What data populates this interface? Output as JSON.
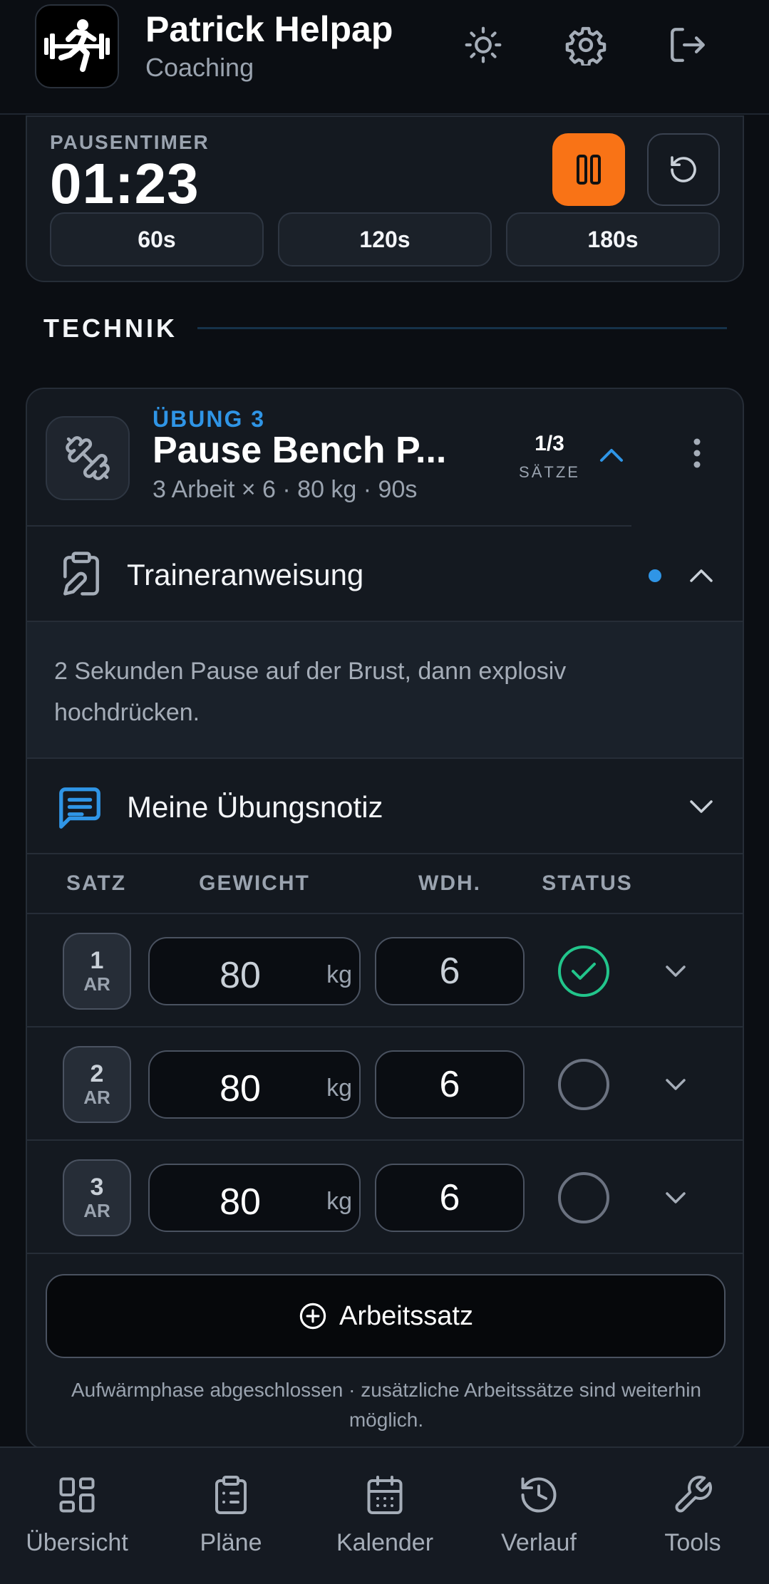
{
  "header": {
    "user_name": "Patrick Helpap",
    "user_role": "Coaching",
    "icons": [
      "sun-icon",
      "gear-icon",
      "logout-icon"
    ]
  },
  "timer": {
    "label": "PAUSENTIMER",
    "value": "01:23",
    "presets": [
      "60s",
      "120s",
      "180s"
    ],
    "accent_color": "#f97316"
  },
  "section": {
    "title": "TECHNIK"
  },
  "exercise": {
    "number_label": "ÜBUNG 3",
    "name": "Pause Bench P...",
    "meta": "3 Arbeit × 6 · 80 kg · 90s",
    "sets_count": "1/3",
    "sets_label": "SÄTZE",
    "coach_instruction_label": "Traineranweisung",
    "coach_instruction_text": "2 Sekunden Pause auf der Brust, dann explosiv hochdrücken.",
    "my_note_label": "Meine Übungsnotiz",
    "accent_color": "#2f95e6"
  },
  "table": {
    "headers": [
      "SATZ",
      "GEWICHT",
      "WDH.",
      "STATUS"
    ],
    "rows": [
      {
        "num": "1",
        "type": "AR",
        "weight": "80",
        "unit": "kg",
        "reps": "6",
        "status": "done"
      },
      {
        "num": "2",
        "type": "AR",
        "weight": "80",
        "unit": "kg",
        "reps": "6",
        "status": "open"
      },
      {
        "num": "3",
        "type": "AR",
        "weight": "80",
        "unit": "kg",
        "reps": "6",
        "status": "open"
      }
    ],
    "done_color": "#22c58b"
  },
  "actions": {
    "add_set_label": "Arbeitssatz",
    "footer_note": "Aufwärmphase abgeschlossen · zusätzliche Arbeitssätze sind weiterhin möglich."
  },
  "nav": {
    "items": [
      {
        "label": "Übersicht",
        "icon": "grid-icon"
      },
      {
        "label": "Pläne",
        "icon": "clipboard-icon"
      },
      {
        "label": "Kalender",
        "icon": "calendar-icon"
      },
      {
        "label": "Verlauf",
        "icon": "history-icon"
      },
      {
        "label": "Tools",
        "icon": "wrench-icon"
      }
    ]
  }
}
